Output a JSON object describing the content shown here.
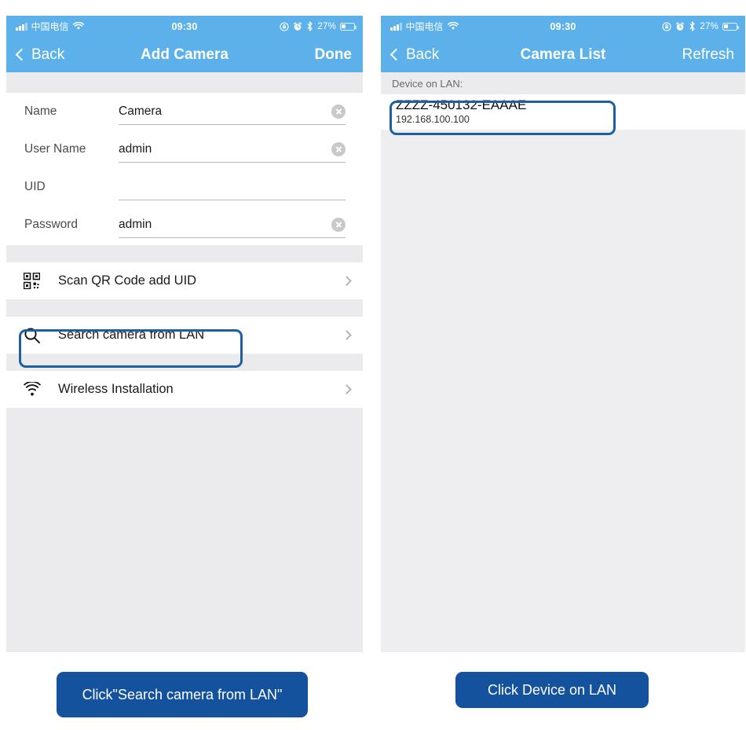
{
  "accent": {
    "header_blue": "#5cb1ea",
    "highlight_blue": "#1d5fa0",
    "cta_blue": "#14529e",
    "panel_gray": "#ebebed"
  },
  "status_bar": {
    "carrier": "中国电信",
    "time": "09:30",
    "battery_percent": "27%",
    "icons": [
      "signal-bars-icon",
      "wifi-icon",
      "rotation-lock-icon",
      "alarm-clock-icon",
      "bluetooth-icon",
      "battery-icon"
    ]
  },
  "left_phone": {
    "nav": {
      "back_label": "Back",
      "title": "Add Camera",
      "action_label": "Done"
    },
    "form": [
      {
        "label": "Name",
        "value": "Camera",
        "has_clear": true
      },
      {
        "label": "User Name",
        "value": "admin",
        "has_clear": true
      },
      {
        "label": "UID",
        "value": "",
        "has_clear": false
      },
      {
        "label": "Password",
        "value": "admin",
        "has_clear": true
      }
    ],
    "menu": [
      {
        "icon": "qr-code-icon",
        "label": "Scan QR Code add UID",
        "highlighted": false
      },
      {
        "icon": "search-icon",
        "label": "Search camera from LAN",
        "highlighted": true
      },
      {
        "icon": "wifi-icon",
        "label": "Wireless Installation",
        "highlighted": false
      }
    ]
  },
  "right_phone": {
    "nav": {
      "back_label": "Back",
      "title": "Camera List",
      "action_label": "Refresh"
    },
    "section_label": "Device on LAN:",
    "devices": [
      {
        "uid": "ZZZZ-450132-EAAAE",
        "ip": "192.168.100.100",
        "highlighted": true
      }
    ]
  },
  "callouts": {
    "left_button": "Click\"Search camera from LAN\"",
    "right_button": "Click Device on LAN"
  }
}
